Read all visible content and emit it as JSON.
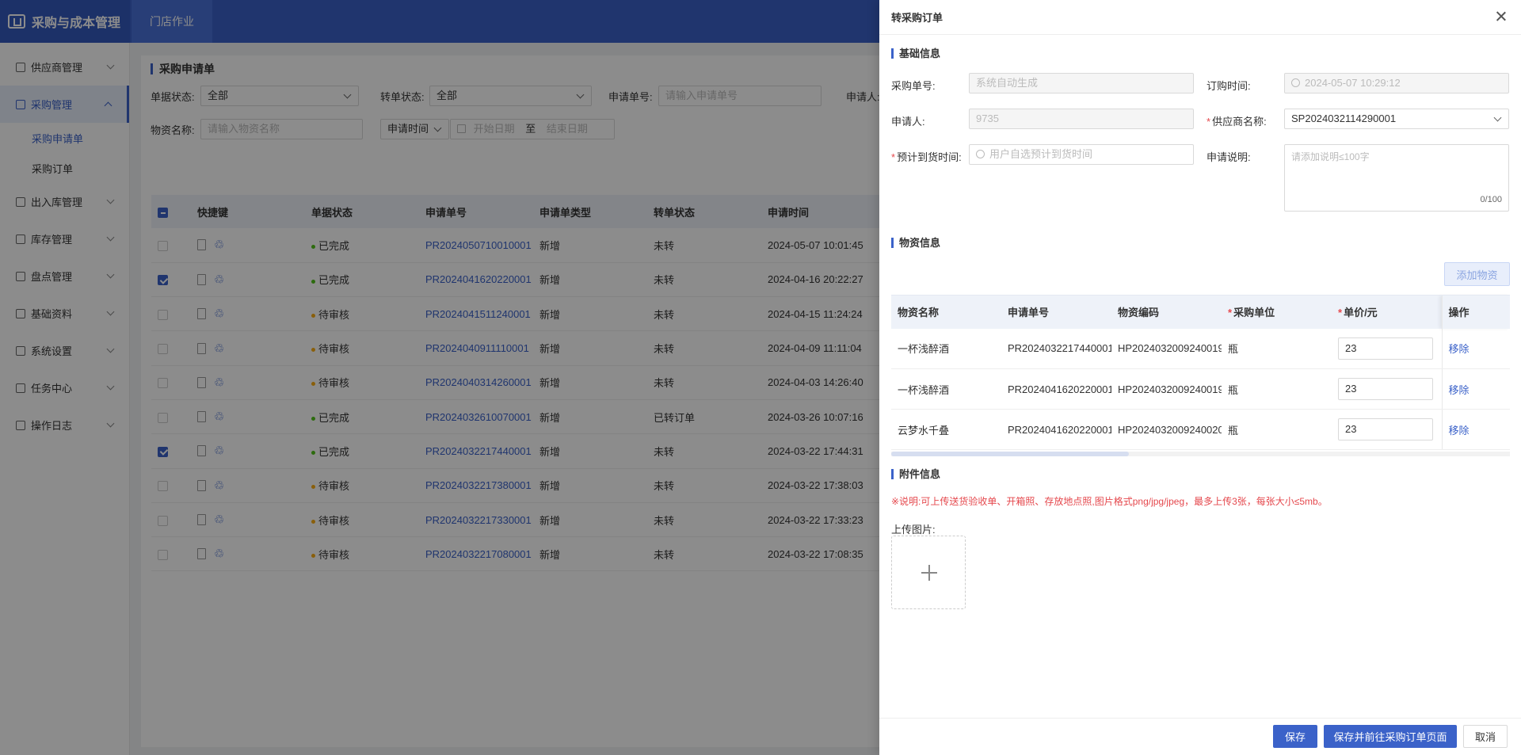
{
  "app": {
    "title": "采购与成本管理",
    "top_tab": "门店作业"
  },
  "sidebar": {
    "items": [
      {
        "label": "供应商管理",
        "icon": "supplier-icon"
      },
      {
        "label": "采购管理",
        "icon": "purchase-icon",
        "active": true,
        "subs": [
          "采购申请单",
          "采购订单"
        ]
      },
      {
        "label": "出入库管理",
        "icon": "warehouse-icon"
      },
      {
        "label": "库存管理",
        "icon": "inventory-icon"
      },
      {
        "label": "盘点管理",
        "icon": "stocktake-icon"
      },
      {
        "label": "基础资料",
        "icon": "basic-data-icon"
      },
      {
        "label": "系统设置",
        "icon": "settings-icon"
      },
      {
        "label": "任务中心",
        "icon": "task-icon"
      },
      {
        "label": "操作日志",
        "icon": "log-icon"
      }
    ]
  },
  "main": {
    "title": "采购申请单",
    "filters": {
      "doc_status_label": "单据状态:",
      "doc_status_value": "全部",
      "trans_status_label": "转单状态:",
      "trans_status_value": "全部",
      "req_no_label": "申请单号:",
      "req_no_placeholder": "请输入申请单号",
      "applicant_label": "申请人:",
      "material_label": "物资名称:",
      "material_placeholder": "请输入物资名称",
      "time_type": "申请时间",
      "start_placeholder": "开始日期",
      "to": "至",
      "end_placeholder": "结束日期"
    },
    "columns": [
      "快捷键",
      "单据状态",
      "申请单号",
      "申请单类型",
      "转单状态",
      "申请时间"
    ],
    "rows": [
      {
        "checked": false,
        "status": "已完成",
        "status_color": "#52c41a",
        "no": "PR2024050710010001",
        "type": "新增",
        "trans": "未转",
        "time": "2024-05-07 10:01:45"
      },
      {
        "checked": true,
        "status": "已完成",
        "status_color": "#52c41a",
        "no": "PR2024041620220001",
        "type": "新增",
        "trans": "未转",
        "time": "2024-04-16 20:22:27"
      },
      {
        "checked": false,
        "status": "待审核",
        "status_color": "#faad14",
        "no": "PR2024041511240001",
        "type": "新增",
        "trans": "未转",
        "time": "2024-04-15 11:24:24"
      },
      {
        "checked": false,
        "status": "待审核",
        "status_color": "#faad14",
        "no": "PR2024040911110001",
        "type": "新增",
        "trans": "未转",
        "time": "2024-04-09 11:11:04"
      },
      {
        "checked": false,
        "status": "待审核",
        "status_color": "#faad14",
        "no": "PR2024040314260001",
        "type": "新增",
        "trans": "未转",
        "time": "2024-04-03 14:26:40"
      },
      {
        "checked": false,
        "status": "已完成",
        "status_color": "#52c41a",
        "no": "PR2024032610070001",
        "type": "新增",
        "trans": "已转订单",
        "time": "2024-03-26 10:07:16"
      },
      {
        "checked": true,
        "status": "已完成",
        "status_color": "#52c41a",
        "no": "PR2024032217440001",
        "type": "新增",
        "trans": "未转",
        "time": "2024-03-22 17:44:31"
      },
      {
        "checked": false,
        "status": "待审核",
        "status_color": "#faad14",
        "no": "PR2024032217380001",
        "type": "新增",
        "trans": "未转",
        "time": "2024-03-22 17:38:03"
      },
      {
        "checked": false,
        "status": "待审核",
        "status_color": "#faad14",
        "no": "PR2024032217330001",
        "type": "新增",
        "trans": "未转",
        "time": "2024-03-22 17:33:23"
      },
      {
        "checked": false,
        "status": "待审核",
        "status_color": "#faad14",
        "no": "PR2024032217080001",
        "type": "新增",
        "trans": "未转",
        "time": "2024-03-22 17:08:35"
      }
    ]
  },
  "drawer": {
    "title": "转采购订单",
    "basic_title": "基础信息",
    "po_no_label": "采购单号:",
    "po_no_value": "系统自动生成",
    "order_time_label": "订购时间:",
    "order_time_value": "2024-05-07 10:29:12",
    "applicant_label": "申请人:",
    "applicant_value": "9735",
    "supplier_label": "供应商名称:",
    "supplier_value": "SP2024032114290001",
    "eta_label": "预计到货时间:",
    "eta_placeholder": "用户自选预计到货时间",
    "remark_label": "申请说明:",
    "remark_placeholder": "请添加说明≤100字",
    "remark_count": "0/100",
    "material_title": "物资信息",
    "add_material": "添加物资",
    "mat_columns": [
      "物资名称",
      "申请单号",
      "物资编码",
      "采购单位",
      "单价/元",
      "操作"
    ],
    "mat_rows": [
      {
        "name": "一杯浅醉酒",
        "req_no": "PR2024032217440001",
        "code": "HP2024032009240019",
        "unit": "瓶",
        "price": "23",
        "op": "移除"
      },
      {
        "name": "一杯浅醉酒",
        "req_no": "PR2024041620220001",
        "code": "HP2024032009240019",
        "unit": "瓶",
        "price": "23",
        "op": "移除"
      },
      {
        "name": "云梦水千叠",
        "req_no": "PR2024041620220001",
        "code": "HP2024032009240020",
        "unit": "瓶",
        "price": "23",
        "op": "移除"
      }
    ],
    "attach_title": "附件信息",
    "attach_note": "※说明:可上传送货验收单、开箱照、存放地点照,图片格式png/jpg/jpeg，最多上传3张，每张大小≤5mb。",
    "upload_label": "上传图片:",
    "save": "保存",
    "save_go": "保存并前往采购订单页面",
    "cancel": "取消"
  }
}
